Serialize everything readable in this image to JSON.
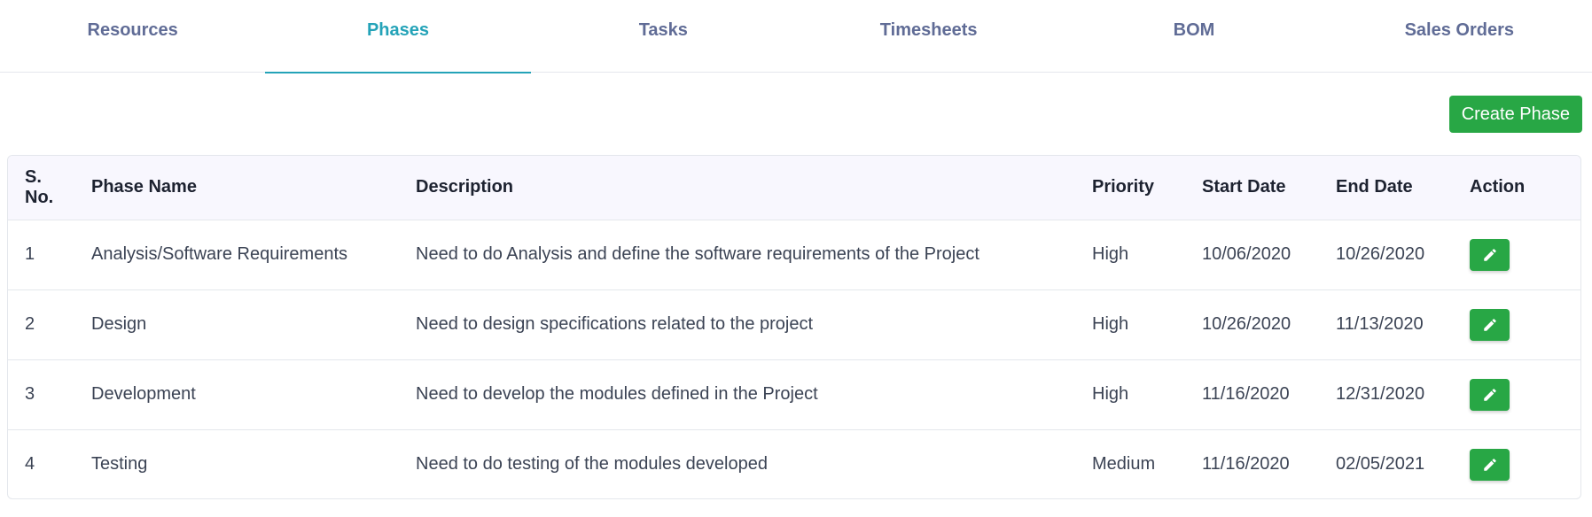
{
  "tabs": [
    {
      "label": "Resources"
    },
    {
      "label": "Phases"
    },
    {
      "label": "Tasks"
    },
    {
      "label": "Timesheets"
    },
    {
      "label": "BOM"
    },
    {
      "label": "Sales Orders"
    }
  ],
  "active_tab": "Phases",
  "toolbar": {
    "create_label": "Create Phase"
  },
  "table": {
    "headers": {
      "sno": "S. No.",
      "phase_name": "Phase Name",
      "description": "Description",
      "priority": "Priority",
      "start_date": "Start Date",
      "end_date": "End Date",
      "action": "Action"
    },
    "rows": [
      {
        "sno": "1",
        "phase_name": "Analysis/Software Requirements",
        "description": "Need to do Analysis and define the software requirements of the Project",
        "priority": "High",
        "start_date": "10/06/2020",
        "end_date": "10/26/2020"
      },
      {
        "sno": "2",
        "phase_name": "Design",
        "description": "Need to design specifications related to the project",
        "priority": "High",
        "start_date": "10/26/2020",
        "end_date": "11/13/2020"
      },
      {
        "sno": "3",
        "phase_name": "Development",
        "description": "Need to develop the modules defined in the Project",
        "priority": "High",
        "start_date": "11/16/2020",
        "end_date": "12/31/2020"
      },
      {
        "sno": "4",
        "phase_name": "Testing",
        "description": "Need to do testing of the modules developed",
        "priority": "Medium",
        "start_date": "11/16/2020",
        "end_date": "02/05/2021"
      }
    ]
  },
  "icons": {
    "edit": "pencil-icon"
  },
  "colors": {
    "accent": "#24a3b8",
    "tab_text": "#606c96",
    "success": "#28a745",
    "header_bg": "#f8f7fe"
  }
}
